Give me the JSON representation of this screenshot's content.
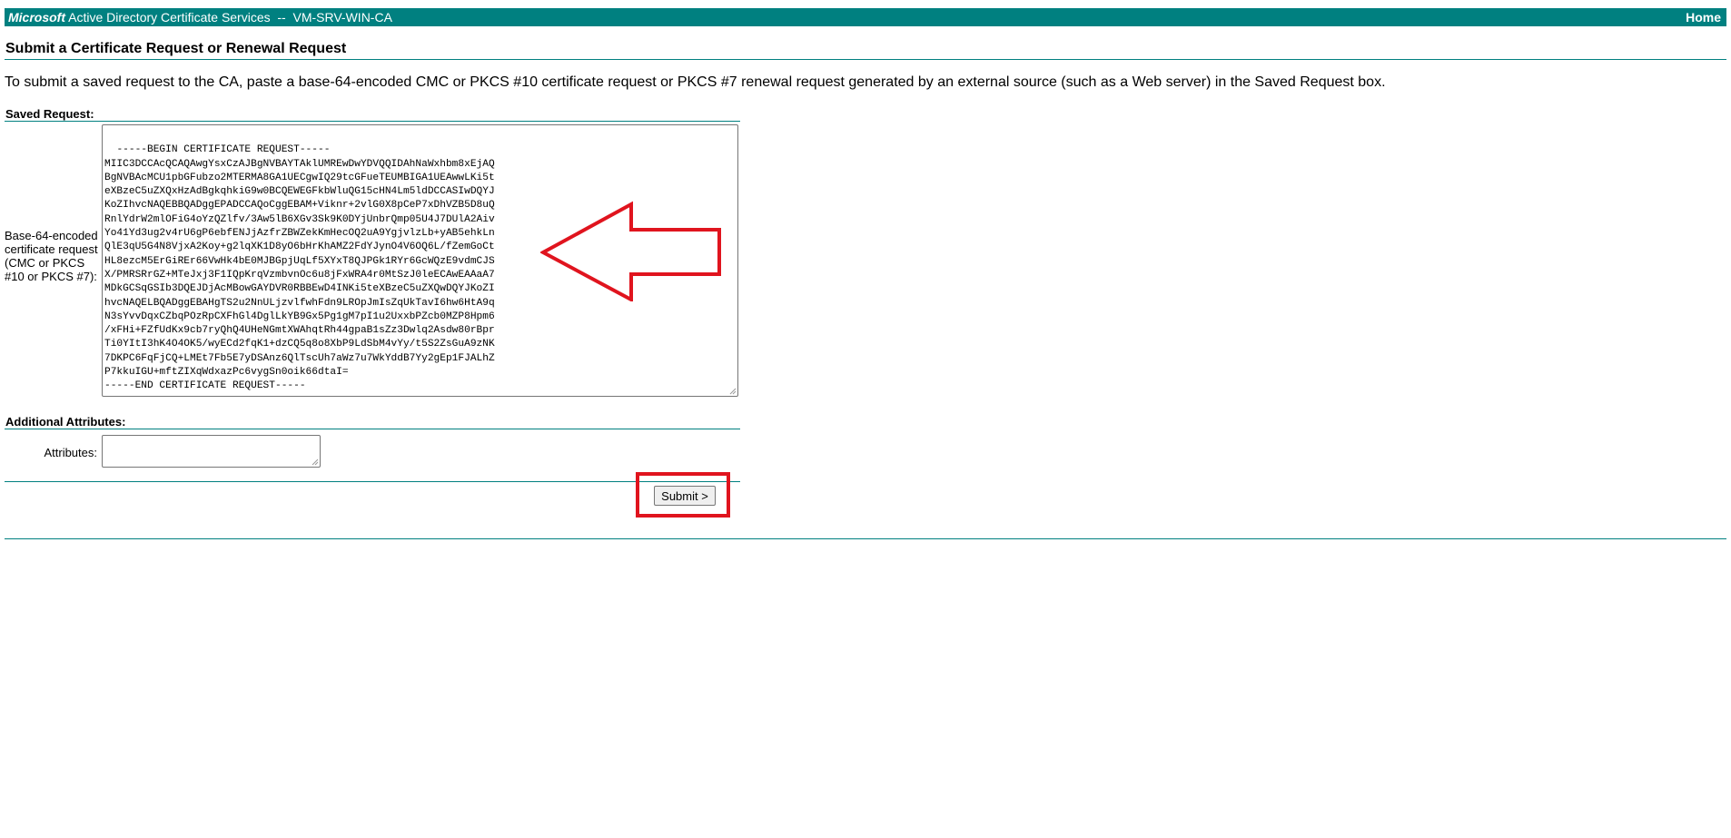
{
  "header": {
    "brand_ms": "Microsoft",
    "brand_rest": " Active Directory Certificate Services  --  VM-SRV-WIN-CA",
    "home_link": "Home"
  },
  "page": {
    "title": "Submit a Certificate Request or Renewal Request",
    "intro": "To submit a saved request to the CA, paste a base-64-encoded CMC or PKCS #10 certificate request or PKCS #7 renewal request generated by an external source (such as a Web server) in the Saved Request box."
  },
  "saved_request": {
    "section_label": "Saved Request:",
    "field_label": "Base-64-encoded certificate request (CMC or PKCS #10 or PKCS #7):",
    "value": "-----BEGIN CERTIFICATE REQUEST-----\nMIIC3DCCAcQCAQAwgYsxCzAJBgNVBAYTAklUMREwDwYDVQQIDAhNaWxhbm8xEjAQ\nBgNVBAcMCU1pbGFubzo2MTERMA8GA1UECgwIQ29tcGFueTEUMBIGA1UEAwwLKi5t\neXBzeC5uZXQxHzAdBgkqhkiG9w0BCQEWEGFkbWluQG15cHN4Lm5ldDCCASIwDQYJ\nKoZIhvcNAQEBBQADggEPADCCAQoCggEBAM+Viknr+2vlG0X8pCeP7xDhVZB5D8uQ\nRnlYdrW2mlOFiG4oYzQZlfv/3Aw5lB6XGv3Sk9K0DYjUnbrQmp05U4J7DUlA2Aiv\nYo41Yd3ug2v4rU6gP6ebfENJjAzfrZBWZekKmHecOQ2uA9YgjvlzLb+yAB5ehkLn\nQlE3qU5G4N8VjxA2Koy+g2lqXK1D8yO6bHrKhAMZ2FdYJynO4V6OQ6L/fZemGoCt\nHL8ezcM5ErGiREr66VwHk4bE0MJBGpjUqLf5XYxT8QJPGk1RYr6GcWQzE9vdmCJS\nX/PMRSRrGZ+MTeJxj3F1IQpKrqVzmbvnOc6u8jFxWRA4r0MtSzJ0leECAwEAAaA7\nMDkGCSqGSIb3DQEJDjAcMBowGAYDVR0RBBEwD4INKi5teXBzeC5uZXQwDQYJKoZI\nhvcNAQELBQADggEBAHgTS2u2NnULjzvlfwhFdn9LROpJmIsZqUkTavI6hw6HtA9q\nN3sYvvDqxCZbqPOzRpCXFhGl4DglLkYB9Gx5Pg1gM7pI1u2UxxbPZcb0MZP8Hpm6\n/xFHi+FZfUdKx9cb7ryQhQ4UHeNGmtXWAhqtRh44gpaB1sZz3Dwlq2Asdw80rBpr\nTi0YItI3hK4O4OK5/wyECd2fqK1+dzCQ5q8o8XbP9LdSbM4vYy/t5S2ZsGuA9zNK\n7DKPC6FqFjCQ+LMEt7Fb5E7yDSAnz6QlTscUh7aWz7u7WkYddB7Yy2gEp1FJALhZ\nP7kkuIGU+mftZIXqWdxazPc6vygSn0oik66dtaI=\n-----END CERTIFICATE REQUEST-----"
  },
  "additional_attributes": {
    "section_label": "Additional Attributes:",
    "attributes_label": "Attributes:",
    "attributes_value": ""
  },
  "actions": {
    "submit_label": "Submit >"
  },
  "icons": {
    "annotation_arrow": "left-arrow-outline-icon",
    "resize_grip": "resize-grip-icon"
  },
  "colors": {
    "header_bg": "#008080",
    "rule": "#008080",
    "annotation": "#e0141e"
  }
}
